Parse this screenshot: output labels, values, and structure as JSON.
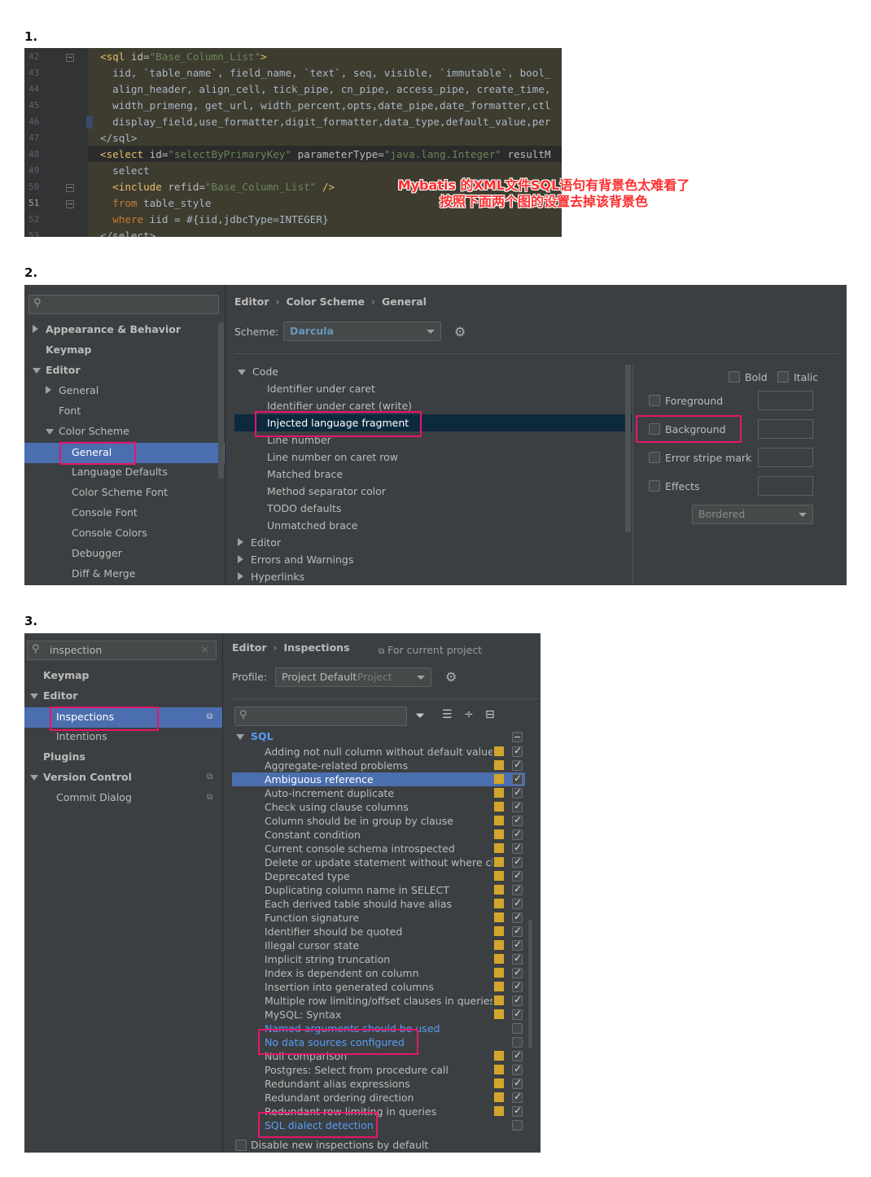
{
  "steps": {
    "s1": "1.",
    "s2": "2.",
    "s3": "3."
  },
  "editor": {
    "line_numbers": [
      "42",
      "43",
      "44",
      "45",
      "46",
      "47",
      "48",
      "49",
      "50",
      "51",
      "52",
      "53"
    ],
    "annotation_line1": "Mybatis 的XML文件SQL语句有背景色太难看了",
    "annotation_line2": "按照下面两个图的设置去掉该背景色",
    "code": {
      "l42_tag": "<sql ",
      "l42_attr": "id=",
      "l42_str": "\"Base_Column_List\"",
      "l42_end": ">",
      "l43": "  iid, `table_name`, field_name, `text`, seq, visible, `immutable`, bool_",
      "l44": "  align_header, align_cell, tick_pipe, cn_pipe, access_pipe, create_time,",
      "l45": "  width_primeng, get_url, width_percent,opts,date_pipe,date_formatter,ctl",
      "l46": "  display_field,use_formatter,digit_formatter,data_type,default_value,per",
      "l47": "</sql>",
      "l48_tag": "<select ",
      "l48_attr": "id=",
      "l48_str": "\"selectByPrimaryKey\"",
      "l48_attr2": " parameterType=",
      "l48_str2": "\"java.lang.Integer\"",
      "l48_attr3": " resultM",
      "l49": "  select",
      "l50_tag": "  <include ",
      "l50_attr": "refid=",
      "l50_str": "\"Base_Column_List\"",
      "l50_end": " />",
      "l51_kw": "  from",
      "l51_rest": " table_style",
      "l52_kw": "  where",
      "l52_rest": " iid = #{iid,jdbcType=INTEGER}",
      "l53": "</select>"
    }
  },
  "color_scheme": {
    "search_placeholder": "",
    "sidebar": {
      "appearance": "Appearance & Behavior",
      "keymap": "Keymap",
      "editor": "Editor",
      "general": "General",
      "font": "Font",
      "color_scheme": "Color Scheme",
      "cs_general": "General",
      "language_defaults": "Language Defaults",
      "color_scheme_font": "Color Scheme Font",
      "console_font": "Console Font",
      "console_colors": "Console Colors",
      "debugger": "Debugger",
      "diff_merge": "Diff & Merge"
    },
    "breadcrumb": [
      "Editor",
      "Color Scheme",
      "General"
    ],
    "scheme_label": "Scheme:",
    "scheme_value": "Darcula",
    "tree": {
      "code": "Code",
      "items": [
        "Identifier under caret",
        "Identifier under caret (write)",
        "Injected language fragment",
        "Line number",
        "Line number on caret row",
        "Matched brace",
        "Method separator color",
        "TODO defaults",
        "Unmatched brace"
      ],
      "editor": "Editor",
      "errors": "Errors and Warnings",
      "hyperlinks": "Hyperlinks"
    },
    "options": {
      "bold": "Bold",
      "italic": "Italic",
      "foreground": "Foreground",
      "background": "Background",
      "error_stripe": "Error stripe mark",
      "effects": "Effects",
      "effects_type": "Bordered"
    }
  },
  "inspections": {
    "search_value": "inspection",
    "sidebar": {
      "keymap": "Keymap",
      "editor": "Editor",
      "inspections": "Inspections",
      "intentions": "Intentions",
      "plugins": "Plugins",
      "version_control": "Version Control",
      "commit_dialog": "Commit Dialog"
    },
    "breadcrumb": [
      "Editor",
      "Inspections"
    ],
    "for_current_project": "For current project",
    "profile_label": "Profile:",
    "profile_value": "Project Default",
    "profile_hint": "Project",
    "group": "SQL",
    "items": [
      {
        "label": "Adding not null column without default value",
        "sev": true,
        "checked": true
      },
      {
        "label": "Aggregate-related problems",
        "sev": true,
        "checked": true
      },
      {
        "label": "Ambiguous reference",
        "sev": true,
        "checked": true
      },
      {
        "label": "Auto-increment duplicate",
        "sev": true,
        "checked": true
      },
      {
        "label": "Check using clause columns",
        "sev": true,
        "checked": true
      },
      {
        "label": "Column should be in group by clause",
        "sev": true,
        "checked": true
      },
      {
        "label": "Constant condition",
        "sev": true,
        "checked": true
      },
      {
        "label": "Current console schema introspected",
        "sev": true,
        "checked": true
      },
      {
        "label": "Delete or update statement without where claus",
        "sev": true,
        "checked": true
      },
      {
        "label": "Deprecated type",
        "sev": true,
        "checked": true
      },
      {
        "label": "Duplicating column name in SELECT",
        "sev": true,
        "checked": true
      },
      {
        "label": "Each derived table should have alias",
        "sev": true,
        "checked": true
      },
      {
        "label": "Function signature",
        "sev": true,
        "checked": true
      },
      {
        "label": "Identifier should be quoted",
        "sev": true,
        "checked": true
      },
      {
        "label": "Illegal cursor state",
        "sev": true,
        "checked": true
      },
      {
        "label": "Implicit string truncation",
        "sev": true,
        "checked": true
      },
      {
        "label": "Index is dependent on column",
        "sev": true,
        "checked": true
      },
      {
        "label": "Insertion into generated columns",
        "sev": true,
        "checked": true
      },
      {
        "label": "Multiple row limiting/offset clauses in queries",
        "sev": true,
        "checked": true
      },
      {
        "label": "MySQL: Syntax",
        "sev": true,
        "checked": true
      },
      {
        "label": "Named arguments should be used",
        "sev": false,
        "checked": false
      },
      {
        "label": "No data sources configured",
        "sev": false,
        "checked": false
      },
      {
        "label": "Null comparison",
        "sev": true,
        "checked": true
      },
      {
        "label": "Postgres: Select from procedure call",
        "sev": true,
        "checked": true
      },
      {
        "label": "Redundant alias expressions",
        "sev": true,
        "checked": true
      },
      {
        "label": "Redundant ordering direction",
        "sev": true,
        "checked": true
      },
      {
        "label": "Redundant row limiting in queries",
        "sev": true,
        "checked": true
      },
      {
        "label": "SQL dialect detection",
        "sev": false,
        "checked": false
      }
    ],
    "disable_new": "Disable new inspections by default"
  },
  "colors": {
    "highlight": "#e6156e",
    "selection": "#4b6eaf",
    "severity": "#d3a52c",
    "link": "#589df6"
  }
}
